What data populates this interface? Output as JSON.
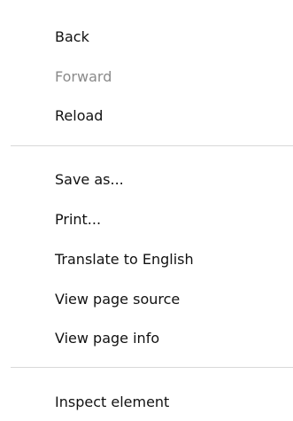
{
  "context_menu": {
    "groups": [
      {
        "items": [
          {
            "label": "Back",
            "enabled": true
          },
          {
            "label": "Forward",
            "enabled": false
          },
          {
            "label": "Reload",
            "enabled": true
          }
        ]
      },
      {
        "items": [
          {
            "label": "Save as...",
            "enabled": true
          },
          {
            "label": "Print...",
            "enabled": true
          },
          {
            "label": "Translate to English",
            "enabled": true
          },
          {
            "label": "View page source",
            "enabled": true
          },
          {
            "label": "View page info",
            "enabled": true
          }
        ]
      },
      {
        "items": [
          {
            "label": "Inspect element",
            "enabled": true
          }
        ]
      }
    ]
  }
}
